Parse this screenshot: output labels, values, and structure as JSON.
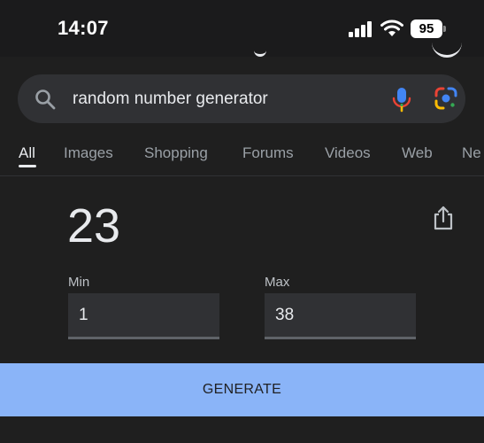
{
  "status_bar": {
    "time": "14:07",
    "battery_level": "95"
  },
  "search": {
    "query": "random number generator"
  },
  "tabs": [
    {
      "label": "All",
      "active": true
    },
    {
      "label": "Images",
      "active": false
    },
    {
      "label": "Shopping",
      "active": false
    },
    {
      "label": "Forums",
      "active": false
    },
    {
      "label": "Videos",
      "active": false
    },
    {
      "label": "Web",
      "active": false
    },
    {
      "label": "Ne",
      "active": false
    }
  ],
  "rng": {
    "result": "23",
    "min_label": "Min",
    "min_value": "1",
    "max_label": "Max",
    "max_value": "38",
    "generate_label": "GENERATE"
  },
  "colors": {
    "background": "#1f1f1f",
    "search_bar": "#303134",
    "accent_button": "#8ab4f8"
  },
  "icons": [
    "signal-icon",
    "wifi-icon",
    "battery-icon",
    "search-icon",
    "mic-icon",
    "google-lens-icon",
    "share-icon"
  ]
}
